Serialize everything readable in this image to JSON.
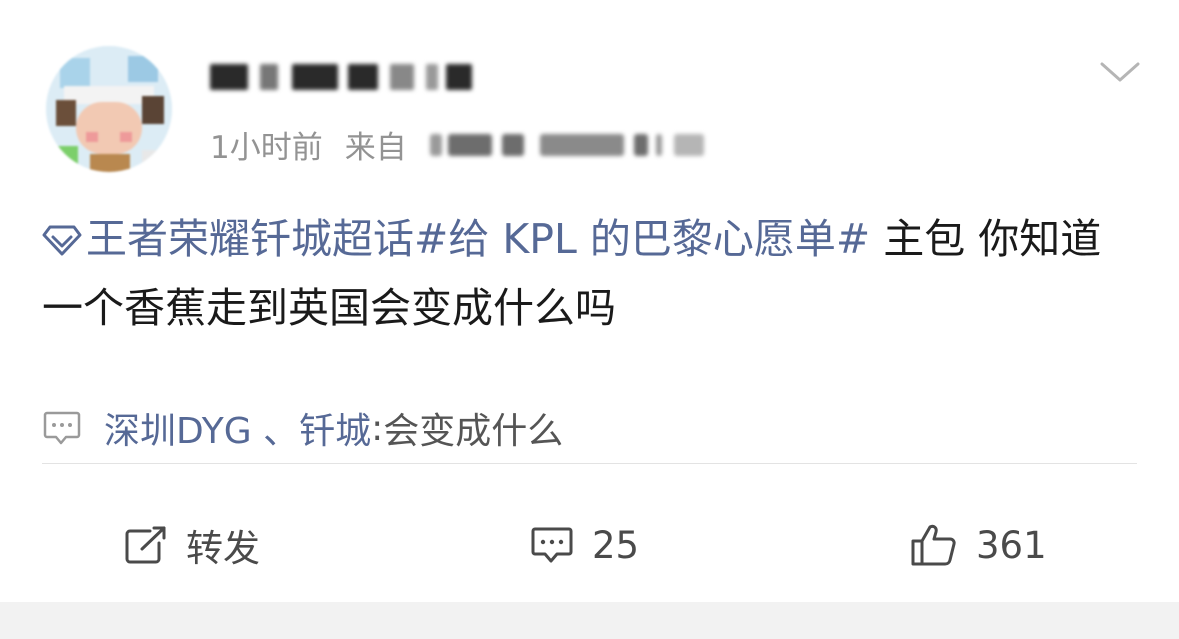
{
  "post": {
    "username": "",
    "time": "1小时前",
    "source_prefix": "来自",
    "source": "",
    "supertopic": "王者荣耀钎城超话",
    "hashtag": "#给 KPL 的巴黎心愿单#",
    "text": " 主包 你知道一个香蕉走到英国会变成什么吗"
  },
  "comment_preview": {
    "author": "深圳DYG 、钎城",
    "separator": ": ",
    "text": "会变成什么"
  },
  "actions": {
    "repost_label": "转发",
    "comment_count": "25",
    "like_count": "361"
  },
  "icons": {
    "more": "chevron-down-icon",
    "supertopic": "supertopic-diamond-icon",
    "comment_preview": "comment-bubble-icon",
    "repost": "repost-icon",
    "comment": "comment-icon",
    "like": "thumbs-up-icon"
  },
  "colors": {
    "link": "#566996",
    "meta": "#939393",
    "text": "#1a1a1a"
  }
}
